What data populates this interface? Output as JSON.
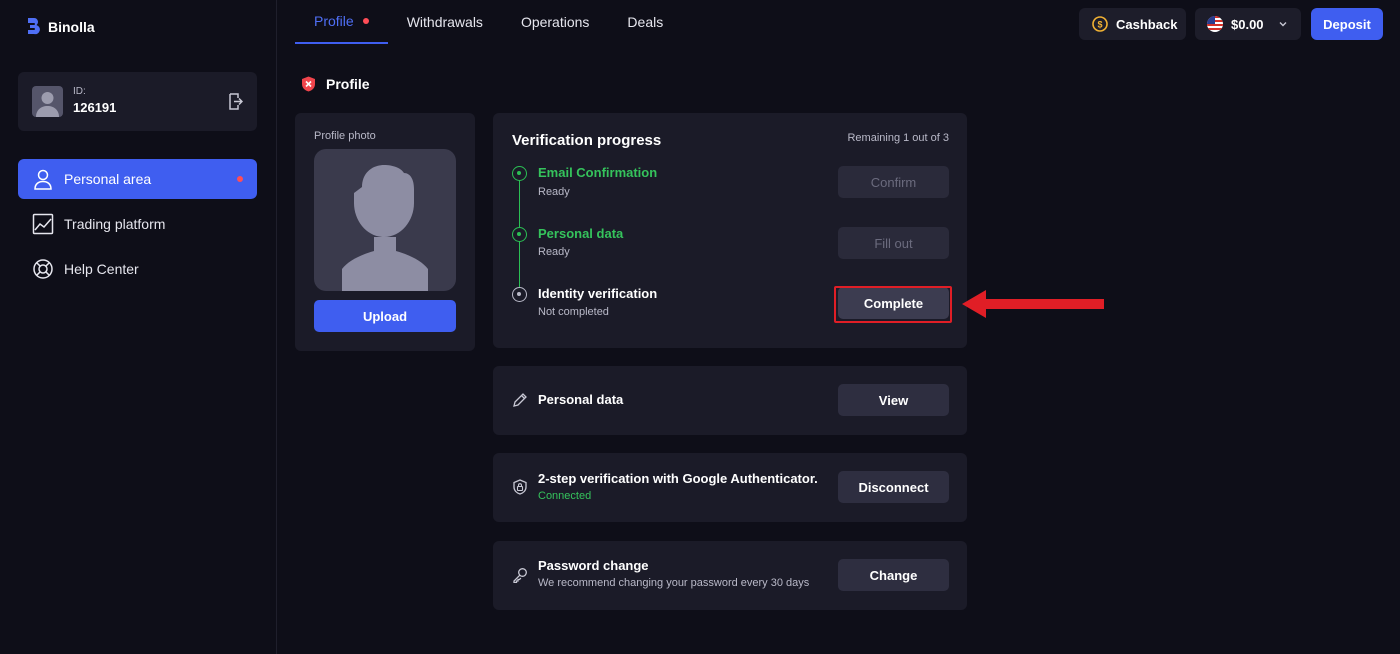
{
  "brand": {
    "name": "Binolla",
    "icon": "binolla-logo-icon"
  },
  "user": {
    "id_label": "ID:",
    "id_value": "126191"
  },
  "sidebar": {
    "items": [
      {
        "label": "Personal area",
        "icon": "user-icon",
        "active": true
      },
      {
        "label": "Trading platform",
        "icon": "chart-icon"
      },
      {
        "label": "Help Center",
        "icon": "lifebuoy-icon"
      }
    ]
  },
  "tabs": [
    {
      "label": "Profile",
      "active": true
    },
    {
      "label": "Withdrawals"
    },
    {
      "label": "Operations"
    },
    {
      "label": "Deals"
    }
  ],
  "header": {
    "cashback_label": "Cashback",
    "balance": "$0.00",
    "deposit_label": "Deposit"
  },
  "page": {
    "title": "Profile"
  },
  "photo": {
    "label": "Profile photo",
    "upload_label": "Upload"
  },
  "verification": {
    "title": "Verification progress",
    "remaining": "Remaining 1 out of 3",
    "steps": [
      {
        "name": "Email Confirmation",
        "status": "Ready",
        "button": "Confirm"
      },
      {
        "name": "Personal data",
        "status": "Ready",
        "button": "Fill out"
      },
      {
        "name": "Identity verification",
        "status": "Not completed",
        "button": "Complete"
      }
    ]
  },
  "sections": {
    "personal_data": {
      "title": "Personal data",
      "button": "View"
    },
    "two_step": {
      "title": "2-step verification with Google Authenticator.",
      "status": "Connected",
      "button": "Disconnect"
    },
    "password": {
      "title": "Password change",
      "subtitle": "We recommend changing your password every 30 days",
      "button": "Change"
    }
  },
  "colors": {
    "accent": "#3f5ef0",
    "success": "#35c35c",
    "alert": "#e01e26",
    "notification_dot": "#ff4d57"
  }
}
